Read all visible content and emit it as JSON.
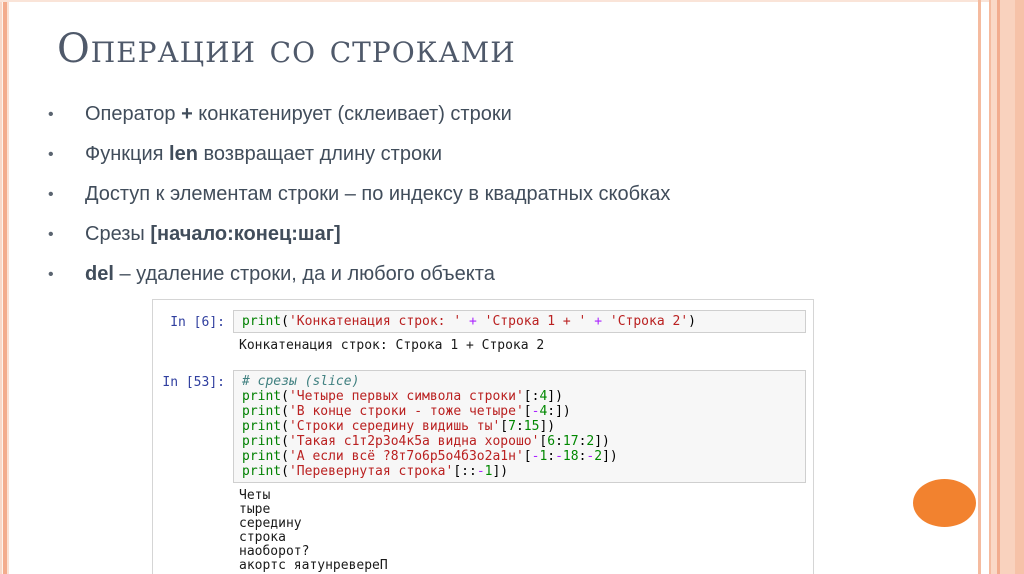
{
  "slide": {
    "title": "Операции со строками",
    "bullets": [
      {
        "segments": [
          {
            "text": "Оператор "
          },
          {
            "text": "+",
            "bold": true
          },
          {
            "text": " конкатенирует (склеивает) строки"
          }
        ]
      },
      {
        "segments": [
          {
            "text": "Функция "
          },
          {
            "text": "len",
            "bold": true
          },
          {
            "text": " возвращает длину строки"
          }
        ]
      },
      {
        "segments": [
          {
            "text": "Доступ к элементам строки – по индексу в квадратных скобках"
          }
        ]
      },
      {
        "segments": [
          {
            "text": "Срезы "
          },
          {
            "text": "[начало:конец:шаг]",
            "bold": true
          }
        ]
      },
      {
        "segments": [
          {
            "text": "del",
            "bold": true
          },
          {
            "text": " – удаление строки, да и любого объекта"
          }
        ]
      }
    ]
  },
  "notebook": {
    "cells": [
      {
        "prompt": "In [6]:",
        "code_lines": [
          [
            {
              "c": "kw",
              "t": "print"
            },
            {
              "c": "pln",
              "t": "("
            },
            {
              "c": "str",
              "t": "'Конкатенация строк: '"
            },
            {
              "c": "op",
              "t": " + "
            },
            {
              "c": "str",
              "t": "'Строка 1 + '"
            },
            {
              "c": "op",
              "t": " + "
            },
            {
              "c": "str",
              "t": "'Строка 2'"
            },
            {
              "c": "pln",
              "t": ")"
            }
          ]
        ],
        "output_lines": [
          "Конкатенация строк: Строка 1 + Строка 2"
        ]
      },
      {
        "prompt": "In [53]:",
        "code_lines": [
          [
            {
              "c": "cmt",
              "t": "# срезы (slice)"
            }
          ],
          [
            {
              "c": "kw",
              "t": "print"
            },
            {
              "c": "pln",
              "t": "("
            },
            {
              "c": "str",
              "t": "'Четыре первых символа строки'"
            },
            {
              "c": "pln",
              "t": "[:"
            },
            {
              "c": "num",
              "t": "4"
            },
            {
              "c": "pln",
              "t": "])"
            }
          ],
          [
            {
              "c": "kw",
              "t": "print"
            },
            {
              "c": "pln",
              "t": "("
            },
            {
              "c": "str",
              "t": "'В конце строки - тоже четыре'"
            },
            {
              "c": "pln",
              "t": "["
            },
            {
              "c": "op",
              "t": "-"
            },
            {
              "c": "num",
              "t": "4"
            },
            {
              "c": "pln",
              "t": ":])"
            }
          ],
          [
            {
              "c": "kw",
              "t": "print"
            },
            {
              "c": "pln",
              "t": "("
            },
            {
              "c": "str",
              "t": "'Строки середину видишь ты'"
            },
            {
              "c": "pln",
              "t": "["
            },
            {
              "c": "num",
              "t": "7"
            },
            {
              "c": "pln",
              "t": ":"
            },
            {
              "c": "num",
              "t": "15"
            },
            {
              "c": "pln",
              "t": "])"
            }
          ],
          [
            {
              "c": "kw",
              "t": "print"
            },
            {
              "c": "pln",
              "t": "("
            },
            {
              "c": "str",
              "t": "'Такая с1т2р3о4к5а видна хорошо'"
            },
            {
              "c": "pln",
              "t": "["
            },
            {
              "c": "num",
              "t": "6"
            },
            {
              "c": "pln",
              "t": ":"
            },
            {
              "c": "num",
              "t": "17"
            },
            {
              "c": "pln",
              "t": ":"
            },
            {
              "c": "num",
              "t": "2"
            },
            {
              "c": "pln",
              "t": "])"
            }
          ],
          [
            {
              "c": "kw",
              "t": "print"
            },
            {
              "c": "pln",
              "t": "("
            },
            {
              "c": "str",
              "t": "'А если всё ?8т7о6р5о4б3о2а1н'"
            },
            {
              "c": "pln",
              "t": "["
            },
            {
              "c": "op",
              "t": "-"
            },
            {
              "c": "num",
              "t": "1"
            },
            {
              "c": "pln",
              "t": ":"
            },
            {
              "c": "op",
              "t": "-"
            },
            {
              "c": "num",
              "t": "18"
            },
            {
              "c": "pln",
              "t": ":"
            },
            {
              "c": "op",
              "t": "-"
            },
            {
              "c": "num",
              "t": "2"
            },
            {
              "c": "pln",
              "t": "])"
            }
          ],
          [
            {
              "c": "kw",
              "t": "print"
            },
            {
              "c": "pln",
              "t": "("
            },
            {
              "c": "str",
              "t": "'Перевернутая строка'"
            },
            {
              "c": "pln",
              "t": "[::"
            },
            {
              "c": "op",
              "t": "-"
            },
            {
              "c": "num",
              "t": "1"
            },
            {
              "c": "pln",
              "t": "])"
            }
          ]
        ],
        "output_lines": [
          "Четы",
          "тыре",
          "середину",
          "строка",
          "наоборот?",
          "акортс яатунревереП"
        ]
      }
    ]
  },
  "colors": {
    "accent_stripe": "#F3AC8D",
    "accent_band": "#F9D2BE",
    "ellipse_orange": "#F2822F",
    "title_text": "#4F596A",
    "body_text": "#414D5B",
    "prompt_blue": "#303F9F",
    "syntax_keyword": "#008000",
    "syntax_string": "#BA2121",
    "syntax_operator": "#AA22FF",
    "syntax_number": "#008800",
    "syntax_comment": "#408080",
    "cell_bg": "#F7F7F7",
    "cell_border": "#CFCFCF"
  }
}
